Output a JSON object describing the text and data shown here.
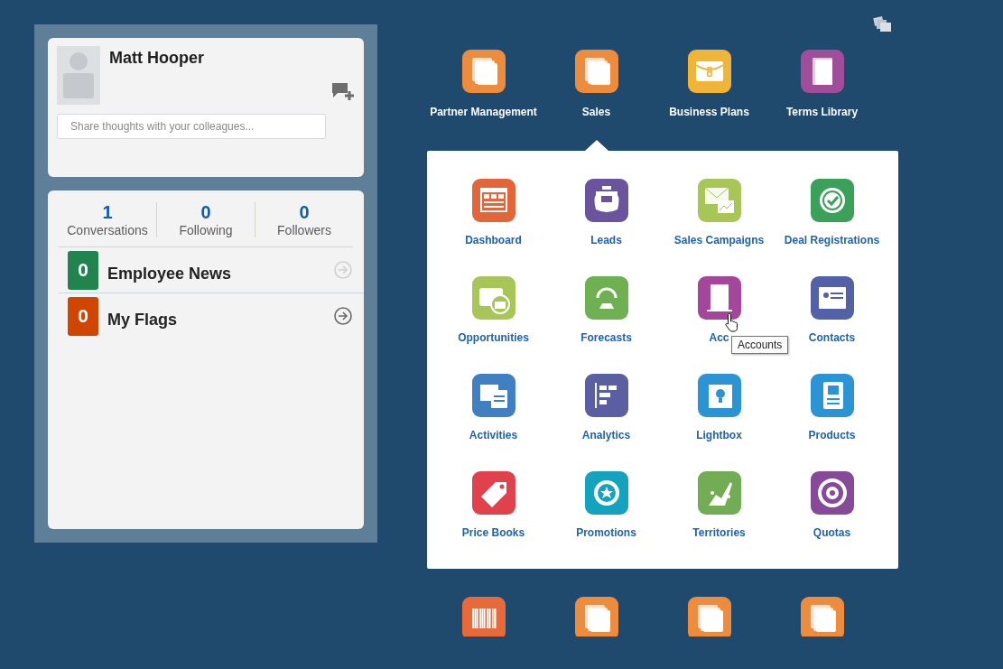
{
  "profile": {
    "name": "Matt Hooper",
    "share_placeholder": "Share thoughts with your colleagues..."
  },
  "stats": [
    {
      "count": "1",
      "label": "Conversations"
    },
    {
      "count": "0",
      "label": "Following"
    },
    {
      "count": "0",
      "label": "Followers"
    }
  ],
  "feeds": [
    {
      "count": "0",
      "label": "Employee News",
      "color": "#21844f",
      "disabled": true
    },
    {
      "count": "0",
      "label": "My Flags",
      "color": "#d04500",
      "disabled": false
    }
  ],
  "top_apps": [
    {
      "label": "Partner Management",
      "kind": "stack",
      "color": "#ec8c3c",
      "selected": false
    },
    {
      "label": "Sales",
      "kind": "stack",
      "color": "#ec8c3c",
      "selected": true
    },
    {
      "label": "Business Plans",
      "kind": "briefcase",
      "color": "#f0b437",
      "selected": false
    },
    {
      "label": "Terms Library",
      "kind": "book",
      "color": "#a04d9a",
      "selected": false
    }
  ],
  "sales_apps": [
    {
      "label": "Dashboard",
      "kind": "dashboard",
      "color": "#e3653a"
    },
    {
      "label": "Leads",
      "kind": "jar",
      "color": "#6a549e"
    },
    {
      "label": "Sales Campaigns",
      "kind": "mail-chart",
      "color": "#a8c558"
    },
    {
      "label": "Deal Registrations",
      "kind": "seal-check",
      "color": "#3aa05a"
    },
    {
      "label": "Opportunities",
      "kind": "case-bank",
      "color": "#a8c558"
    },
    {
      "label": "Forecasts",
      "kind": "globe",
      "color": "#6fb052"
    },
    {
      "label": "Acc",
      "kind": "building",
      "color": "#a4479a",
      "tooltip": "Accounts"
    },
    {
      "label": "Contacts",
      "kind": "contact",
      "color": "#5362a6"
    },
    {
      "label": "Activities",
      "kind": "calendar",
      "color": "#3f7fc2"
    },
    {
      "label": "Analytics",
      "kind": "chart",
      "color": "#5a5fa2"
    },
    {
      "label": "Lightbox",
      "kind": "bulb",
      "color": "#2b94d4"
    },
    {
      "label": "Products",
      "kind": "sheet",
      "color": "#2b94d4"
    },
    {
      "label": "Price Books",
      "kind": "tag",
      "color": "#e0414c"
    },
    {
      "label": "Promotions",
      "kind": "seal-star",
      "color": "#14a3bf"
    },
    {
      "label": "Territories",
      "kind": "figures",
      "color": "#72ad55"
    },
    {
      "label": "Quotas",
      "kind": "target",
      "color": "#864a98"
    }
  ],
  "more_apps": [
    {
      "kind": "barcode",
      "color": "#e86a3a"
    },
    {
      "kind": "stack",
      "color": "#ec8c3c"
    },
    {
      "kind": "stack",
      "color": "#ec8c3c"
    },
    {
      "kind": "stack",
      "color": "#ec8c3c"
    }
  ]
}
